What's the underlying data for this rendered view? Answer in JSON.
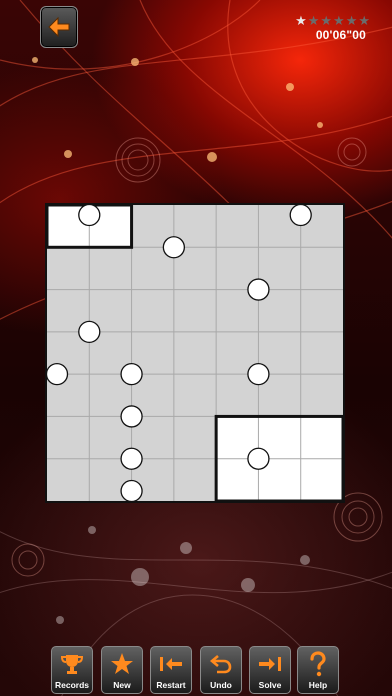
{
  "header": {
    "back_icon": "left-arrow-icon",
    "stars_total": 6,
    "stars_earned": 1,
    "timer": "00'06\"00"
  },
  "colors": {
    "accent_orange": "#ff8a1e",
    "board_gray": "#d3d3d3",
    "region_white": "#ffffff",
    "grid_line": "#a9a9a9",
    "star_lit": "#e8e8e8",
    "star_dim": "#6b6b6b"
  },
  "board": {
    "rows": 7,
    "cols": 7,
    "white_regions": [
      {
        "row": 0,
        "col": 0,
        "rows": 1,
        "cols": 2
      },
      {
        "row": 5,
        "col": 4,
        "rows": 2,
        "cols": 3
      }
    ],
    "dots": [
      {
        "row": 0,
        "col": 1
      },
      {
        "row": 0,
        "col": 6
      },
      {
        "row": 1,
        "col": 3
      },
      {
        "row": 2,
        "col": 5
      },
      {
        "row": 3,
        "col": 1
      },
      {
        "row": 4,
        "col": 2
      },
      {
        "row": 4,
        "col": 0
      },
      {
        "row": 4,
        "col": 5
      },
      {
        "row": 5,
        "col": 2
      },
      {
        "row": 6,
        "col": 2
      },
      {
        "row": 6,
        "col": 5
      },
      {
        "row": 7,
        "col": 2
      }
    ]
  },
  "toolbar": {
    "records": {
      "label": "Records",
      "icon": "trophy-icon"
    },
    "new": {
      "label": "New",
      "icon": "star-icon"
    },
    "restart": {
      "label": "Restart",
      "icon": "skip-back-icon"
    },
    "undo": {
      "label": "Undo",
      "icon": "undo-icon"
    },
    "solve": {
      "label": "Solve",
      "icon": "skip-forward-icon"
    },
    "help": {
      "label": "Help",
      "icon": "question-icon"
    }
  }
}
